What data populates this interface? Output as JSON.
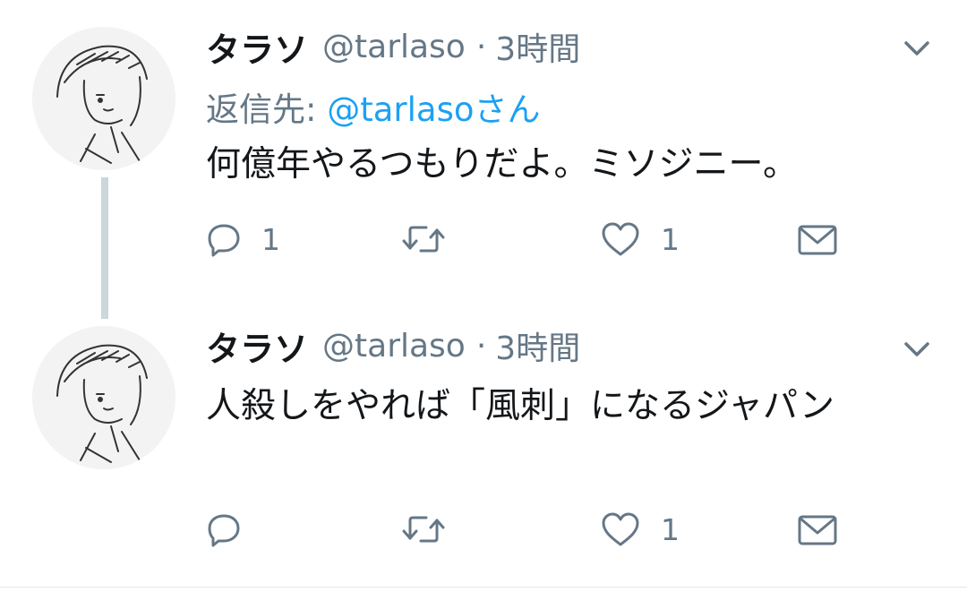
{
  "tweets": [
    {
      "name": "タラソ",
      "handle": "@tarlaso",
      "separator": "·",
      "time": "3時間",
      "reply_label": "返信先:",
      "reply_mention": "@tarlasoさん",
      "text": "何億年やるつもりだよ。ミソジニー。",
      "reply_count": "1",
      "retweet_count": "",
      "like_count": "1"
    },
    {
      "name": "タラソ",
      "handle": "@tarlaso",
      "separator": "·",
      "time": "3時間",
      "text": "人殺しをやれば「風刺」になるジャパン",
      "reply_count": "",
      "retweet_count": "",
      "like_count": "1"
    }
  ],
  "icons": {
    "reply": "reply-icon",
    "retweet": "retweet-icon",
    "like": "heart-icon",
    "dm": "envelope-icon",
    "menu": "chevron-down-icon"
  },
  "colors": {
    "text": "#14171a",
    "secondary": "#657786",
    "link": "#1da1f2",
    "thread_line": "#ccd6dd"
  }
}
